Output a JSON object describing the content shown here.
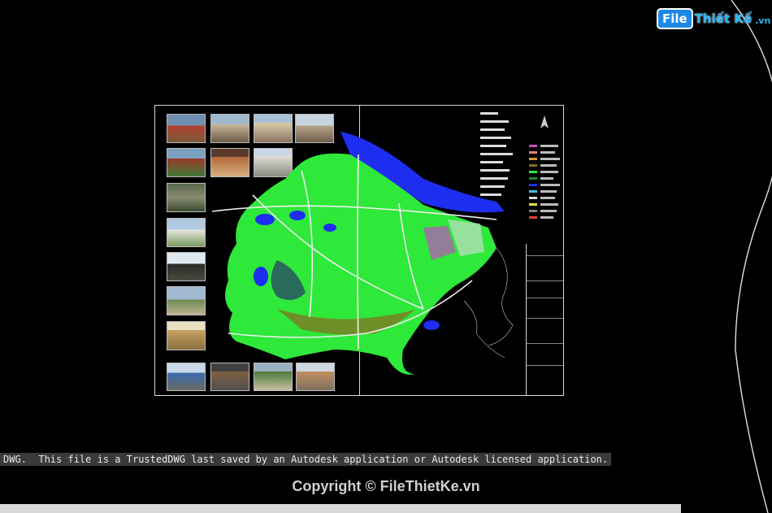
{
  "watermark": {
    "logo_box": "File",
    "logo_rest": "Thiết Kế",
    "logo_ext": ".vn"
  },
  "status_line": "DWG.  This file is a TrustedDWG last saved by an Autodesk application or Autodesk licensed application.",
  "copyright": "Copyright © FileThietKe.vn",
  "colors": {
    "background": "#000000",
    "land_green": "#2ee83a",
    "water_blue": "#1d2ef0",
    "sheet_border": "#d9d9d9",
    "status_bg": "#3a3a3a"
  },
  "icons": [
    "north-arrow-icon",
    "logo-icon"
  ]
}
